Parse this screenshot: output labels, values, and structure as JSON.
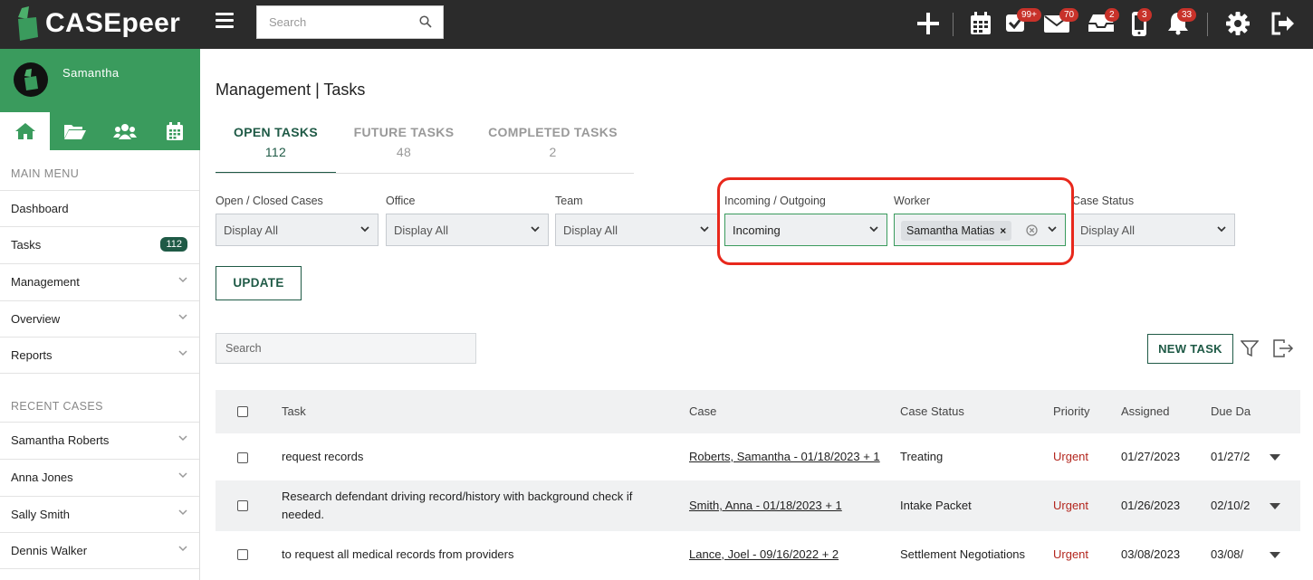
{
  "app": {
    "logo_text": "CASEpeer"
  },
  "topbar": {
    "search_placeholder": "Search",
    "badges": {
      "tasks": "99+",
      "mail": "70",
      "inbox": "2",
      "phone": "3",
      "notifications": "33"
    }
  },
  "sidebar": {
    "user_name": "Samantha",
    "main_menu_heading": "MAIN MENU",
    "main_menu": [
      {
        "label": "Dashboard"
      },
      {
        "label": "Tasks",
        "count": "112"
      },
      {
        "label": "Management"
      },
      {
        "label": "Overview"
      },
      {
        "label": "Reports"
      }
    ],
    "recent_heading": "RECENT CASES",
    "recent": [
      {
        "label": "Samantha Roberts"
      },
      {
        "label": "Anna Jones"
      },
      {
        "label": "Sally Smith"
      },
      {
        "label": "Dennis Walker"
      }
    ]
  },
  "page": {
    "title": "Management | Tasks"
  },
  "tabs": [
    {
      "label": "OPEN TASKS",
      "count": "112"
    },
    {
      "label": "FUTURE TASKS",
      "count": "48"
    },
    {
      "label": "COMPLETED TASKS",
      "count": "2"
    }
  ],
  "filters": {
    "open_closed": {
      "label": "Open / Closed Cases",
      "value": "Display All"
    },
    "office": {
      "label": "Office",
      "value": "Display All"
    },
    "team": {
      "label": "Team",
      "value": "Display All"
    },
    "incoming": {
      "label": "Incoming / Outgoing",
      "value": "Incoming"
    },
    "worker": {
      "label": "Worker",
      "chip": "Samantha Matias"
    },
    "case_status": {
      "label": "Case Status",
      "value": "Display All"
    }
  },
  "buttons": {
    "update": "UPDATE",
    "new_task": "NEW TASK"
  },
  "table": {
    "search_placeholder": "Search",
    "headers": {
      "task": "Task",
      "case": "Case",
      "case_status": "Case Status",
      "priority": "Priority",
      "assigned": "Assigned",
      "due": "Due Da"
    },
    "rows": [
      {
        "task": "request records",
        "case": "Roberts, Samantha - 01/18/2023 + 1",
        "status": "Treating",
        "priority": "Urgent",
        "assigned": "01/27/2023",
        "due": "01/27/2"
      },
      {
        "task_line1": "Research defendant driving record/history with background check if",
        "task_line2": "needed.",
        "case": "Smith, Anna - 01/18/2023 + 1",
        "status": "Intake Packet",
        "priority": "Urgent",
        "assigned": "01/26/2023",
        "due": "02/10/2"
      },
      {
        "task": "to request all medical records from providers",
        "case": "Lance, Joel - 09/16/2022 + 2",
        "status": "Settlement Negotiations",
        "priority": "Urgent",
        "assigned": "03/08/2023",
        "due": "03/08/"
      }
    ]
  }
}
